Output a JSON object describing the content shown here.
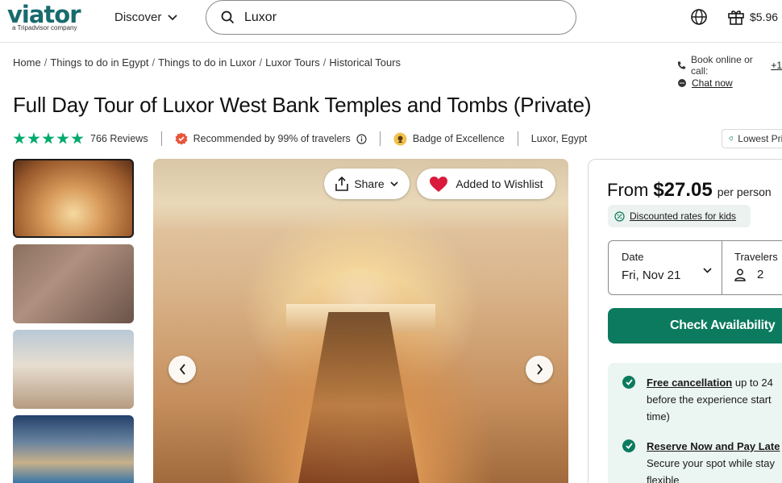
{
  "header": {
    "logo_text": "viator",
    "logo_sub": "a Tripadvisor company",
    "discover_label": "Discover",
    "search_value": "Luxor",
    "wallet_amount": "$5.96"
  },
  "breadcrumbs": [
    "Home",
    "Things to do in Egypt",
    "Things to do in Luxor",
    "Luxor Tours",
    "Historical Tours"
  ],
  "contact": {
    "book_text": "Book online or call:",
    "book_phone": "+1",
    "chat_label": "Chat now"
  },
  "title": "Full Day Tour of Luxor West Bank Temples and Tombs (Private)",
  "meta": {
    "rating_stars": 5,
    "reviews": "766 Reviews",
    "recommended": "Recommended by 99% of travelers",
    "badge": "Badge of Excellence",
    "location": "Luxor, Egypt",
    "lowest_price": "Lowest Price"
  },
  "gallery": {
    "share_label": "Share",
    "wishlist_label": "Added to Wishlist"
  },
  "booking": {
    "from_label": "From",
    "price": "$27.05",
    "per_label": "per person",
    "kids_label": "Discounted rates for kids",
    "date_label": "Date",
    "date_value": "Fri, Nov 21",
    "travelers_label": "Travelers",
    "travelers_value": "2",
    "check_label": "Check Availability",
    "perk1_title": "Free cancellation",
    "perk1_line1": "up to 24",
    "perk1_line2": "before the experience start",
    "perk1_line3": "time)",
    "perk2_title": "Reserve Now and Pay Late",
    "perk2_line1": "Secure your spot while stay",
    "perk2_line2": "flexible"
  },
  "colors": {
    "brand": "#186b6d",
    "rating_green": "#00aa6c",
    "cta": "#0b7a5e",
    "heart": "#d91a3c"
  }
}
